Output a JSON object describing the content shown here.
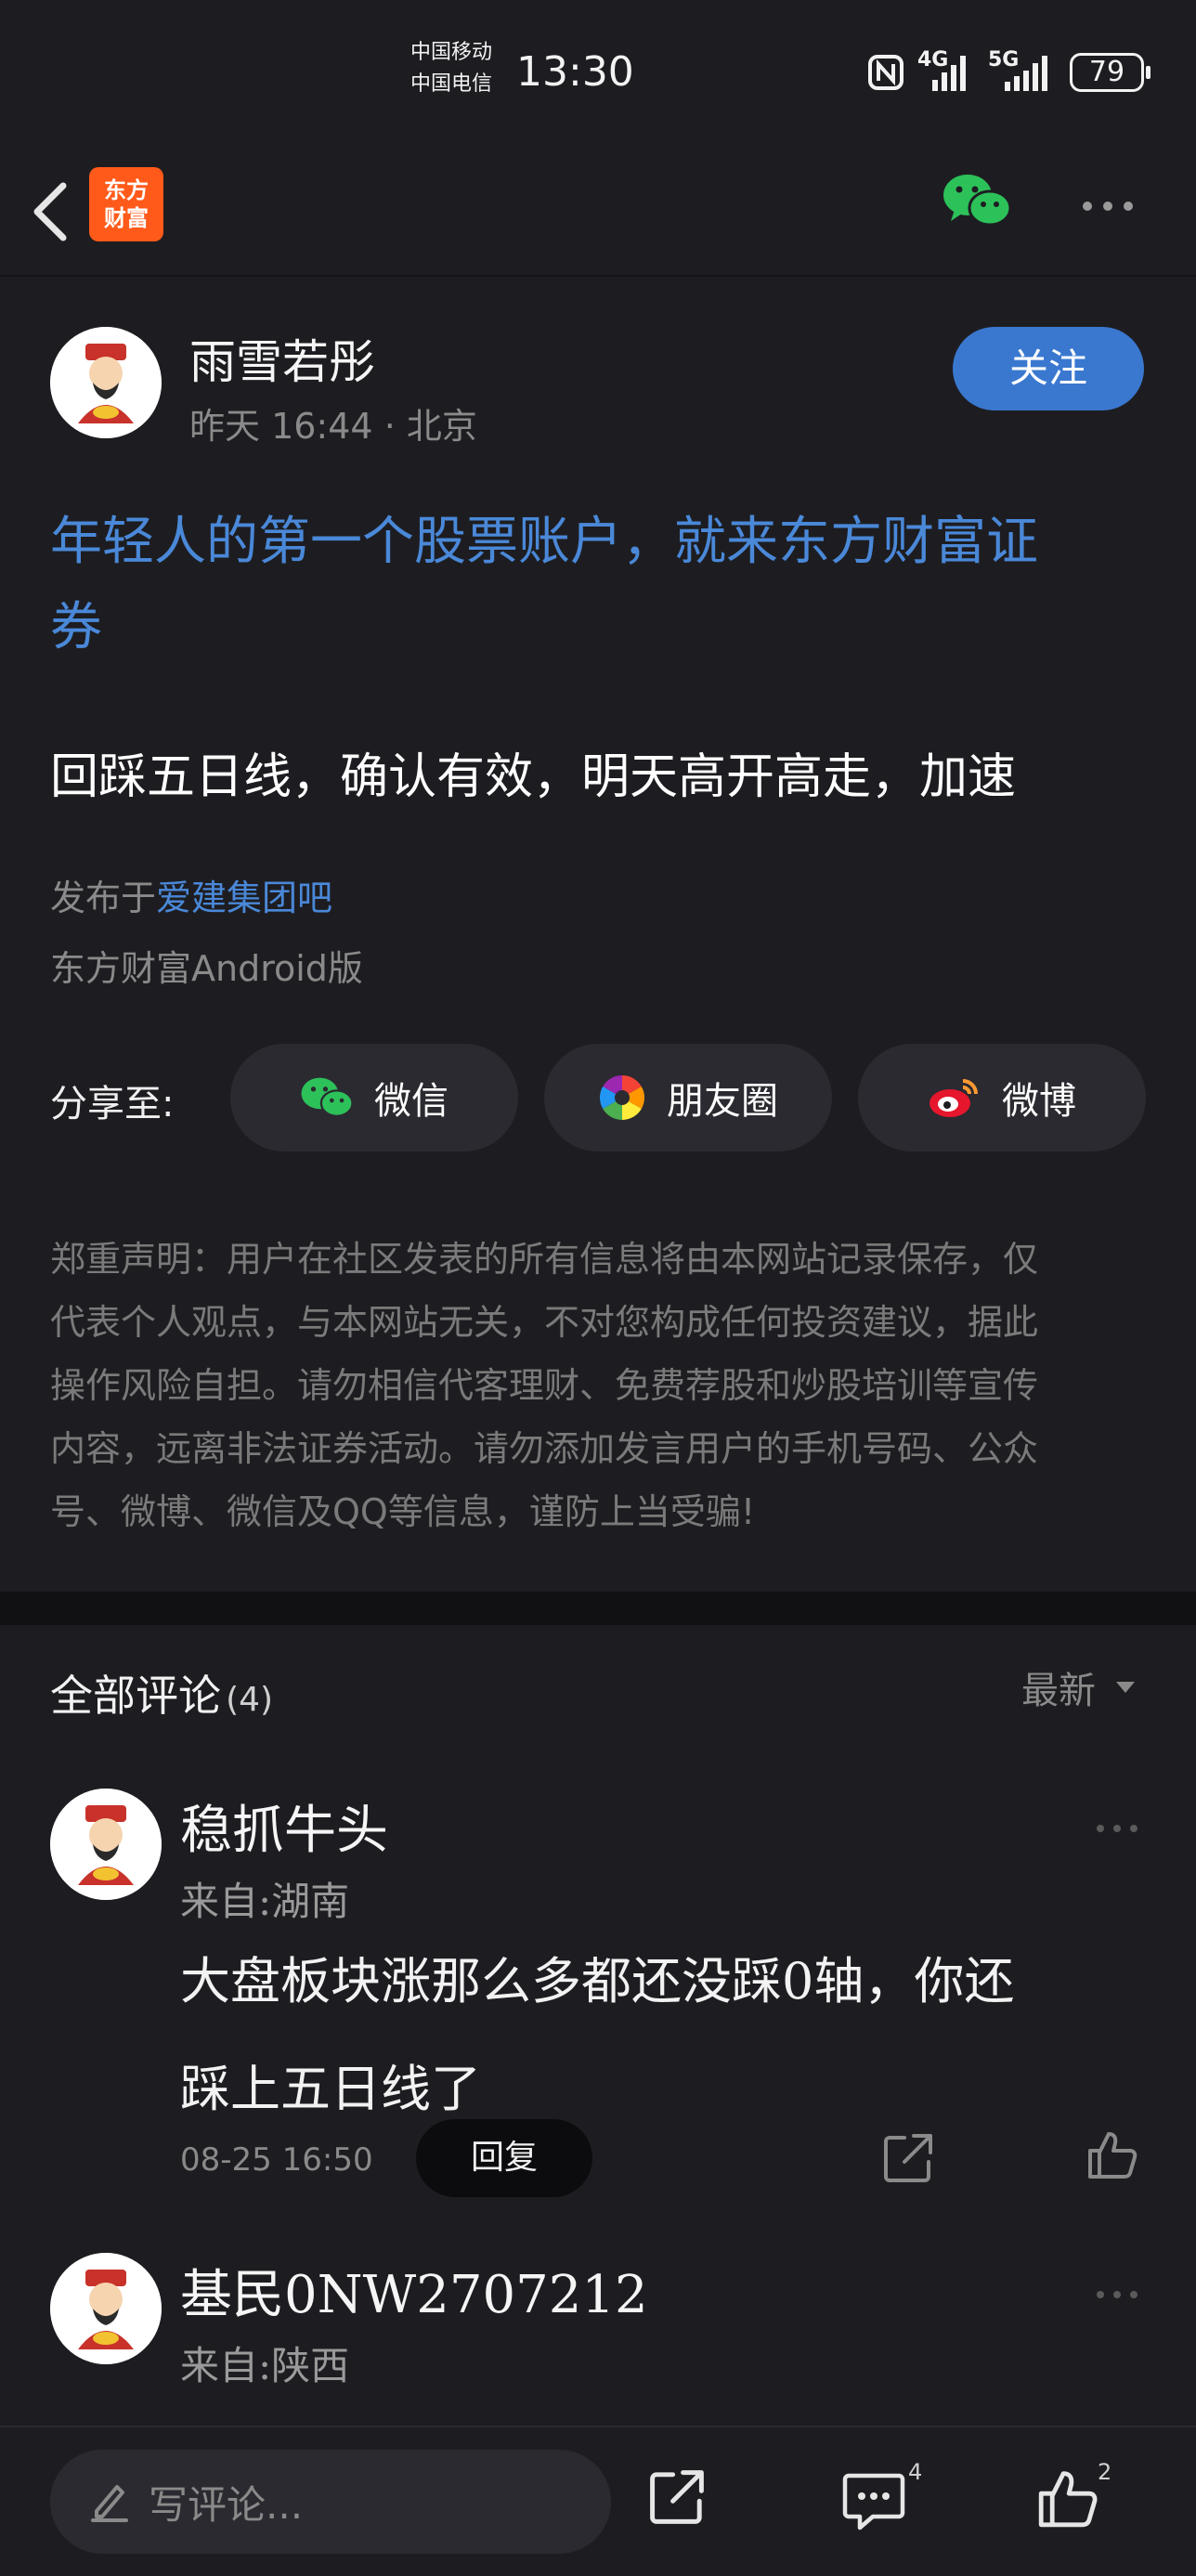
{
  "status_bar": {
    "carrier_1": "中国移动",
    "carrier_2": "中国电信",
    "time": "13:30",
    "network_1": "4G",
    "network_2": "5G",
    "battery": "79"
  },
  "nav": {
    "logo_line1": "东方",
    "logo_line2": "财富"
  },
  "post": {
    "author": "雨雪若彤",
    "time": "昨天 16:44",
    "location": "北京",
    "follow_label": "关注",
    "promo_title": "年轻人的第一个股票账户，就来东方财富证券",
    "promo_line1": "年轻人的第一个股票账户，就来东方财富证",
    "promo_line2": "券",
    "content": "回踩五日线，确认有效，明天高开高走，加速",
    "published_prefix": "发布于",
    "published_bar": "爱建集团吧",
    "client": "东方财富Android版"
  },
  "share": {
    "label": "分享至:",
    "wechat": "微信",
    "moments": "朋友圈",
    "weibo": "微博"
  },
  "disclaimer": {
    "line1": "郑重声明：用户在社区发表的所有信息将由本网站记录保存，仅",
    "line2": "代表个人观点，与本网站无关，不对您构成任何投资建议，据此",
    "line3": "操作风险自担。请勿相信代客理财、免费荐股和炒股培训等宣传",
    "line4": "内容，远离非法证券活动。请勿添加发言用户的手机号码、公众",
    "line5": "号、微博、微信及QQ等信息，谨防上当受骗!"
  },
  "comments_section": {
    "title": "全部评论",
    "count": "(4)",
    "sort": "最新"
  },
  "comments": [
    {
      "name": "稳抓牛头",
      "location": "来自:湖南",
      "text_line1": "大盘板块涨那么多都还没踩0轴，你还",
      "text_line2": "踩上五日线了",
      "time": "08-25 16:50",
      "reply_label": "回复"
    },
    {
      "name": "基民0NW2707212",
      "location": "来自:陕西"
    }
  ],
  "bottom_bar": {
    "placeholder": "写评论...",
    "comment_count": "4",
    "like_count": "2"
  }
}
